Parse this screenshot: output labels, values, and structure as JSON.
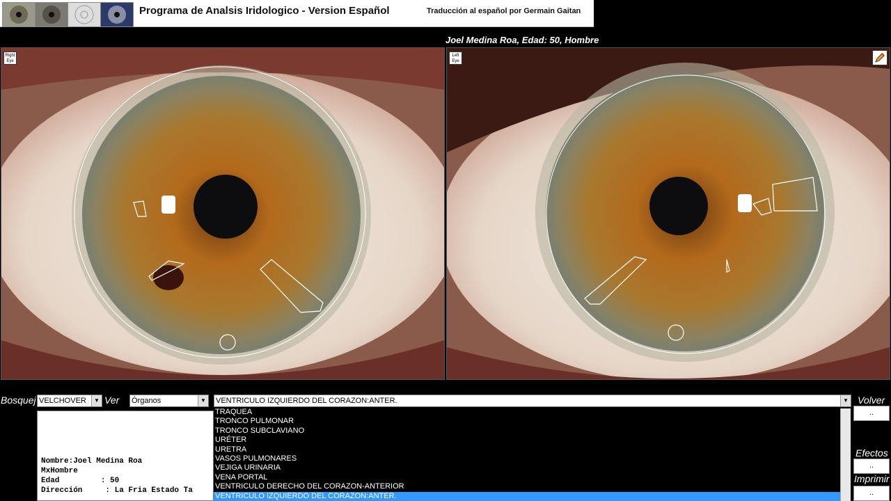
{
  "header": {
    "app_title": "Programa de Analsis Iridologico - Version Español",
    "translation_credit": "Traducción al español por Germain Gaitan"
  },
  "patient_header": "Joel Medina Roa, Edad: 50, Hombre",
  "eyes": {
    "right_label_1": "Right",
    "right_label_2": "Eye",
    "left_label_1": "Left",
    "left_label_2": "Eye"
  },
  "controls": {
    "bosquejo_label": "Bosquej",
    "bosquejo_value": "VELCHOVER",
    "ver_label": "Ver",
    "ver_value": "Órganos",
    "organ_selected": "VENTRICULO IZQUIERDO DEL CORAZON:ANTER."
  },
  "organ_list": [
    "TRAQUEA",
    "TRONCO PULMONAR",
    "TRONCO SUBCLAVIANO",
    "URÉTER",
    "URETRA",
    "VASOS PULMONARES",
    "VEJIGA URINARIA",
    "VENA PORTAL",
    "VENTRICULO DERECHO DEL CORAZON-ANTERIOR",
    "VENTRICULO IZQUIERDO DEL CORAZON:ANTER."
  ],
  "organ_list_selected_index": 9,
  "patient_info": {
    "name_line": "Nombre:Joel Medina Roa",
    "sex_line": "MxHombre",
    "age_line": "Edad         : 50",
    "address_line": "Dirección     : La Fria Estado Ta"
  },
  "side_buttons": {
    "volver_label": "Volver",
    "volver_btn": "..",
    "efectos_label": "Efectos",
    "efectos_btn": "..",
    "imprimir_label": "Imprimir",
    "imprimir_btn": ".."
  },
  "colors": {
    "selection": "#3399ff",
    "iris": "#b5721f"
  }
}
